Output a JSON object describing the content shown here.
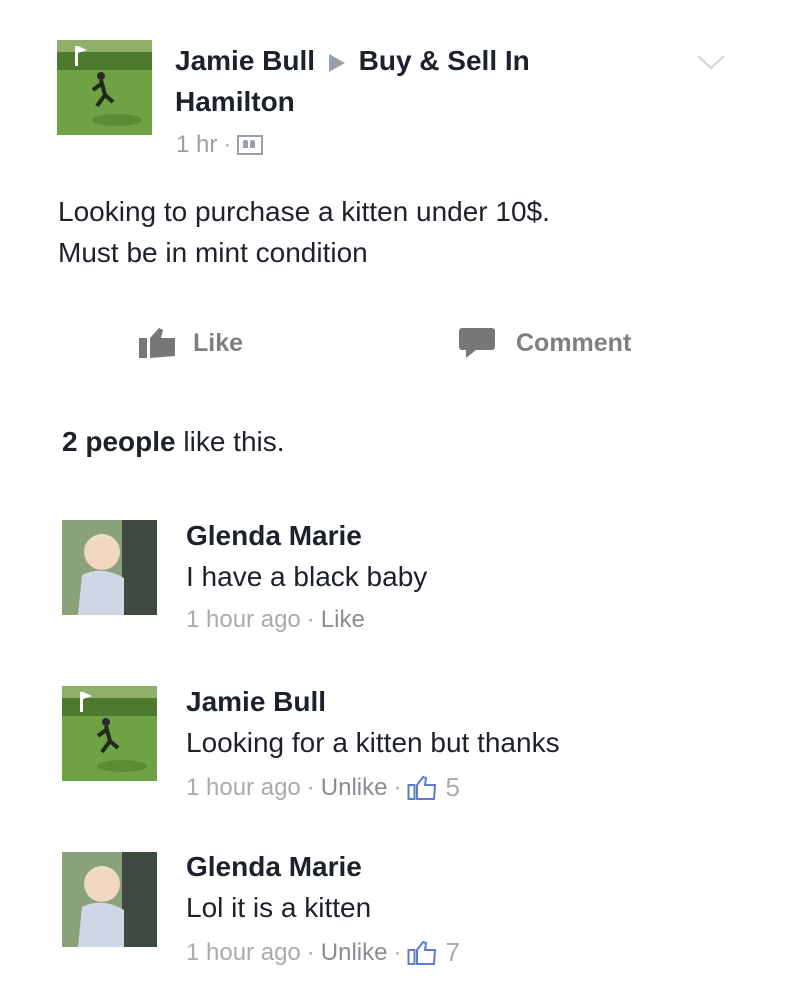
{
  "post": {
    "author": "Jamie Bull",
    "group": "Buy & Sell In",
    "group_line2": "Hamilton",
    "time": "1 hr",
    "text_line1": "Looking to purchase a kitten under 10$.",
    "text_line2": "Must be in mint condition",
    "like_label": "Like",
    "comment_label": "Comment",
    "likes_count_bold": "2 people",
    "likes_suffix": " like this."
  },
  "comments": [
    {
      "author": "Glenda Marie",
      "text": "I have a black baby",
      "time": "1 hour ago",
      "action": "Like",
      "likes": ""
    },
    {
      "author": "Jamie Bull",
      "text": "Looking for a kitten but thanks",
      "time": "1 hour ago",
      "action": "Unlike",
      "likes": "5"
    },
    {
      "author": "Glenda Marie",
      "text": "Lol it is a kitten",
      "time": "1 hour ago",
      "action": "Unlike",
      "likes": "7"
    }
  ],
  "colors": {
    "meta": "#9aa0a8",
    "action": "#7f7f7f",
    "thumb_blue": "#5b7bd5"
  }
}
